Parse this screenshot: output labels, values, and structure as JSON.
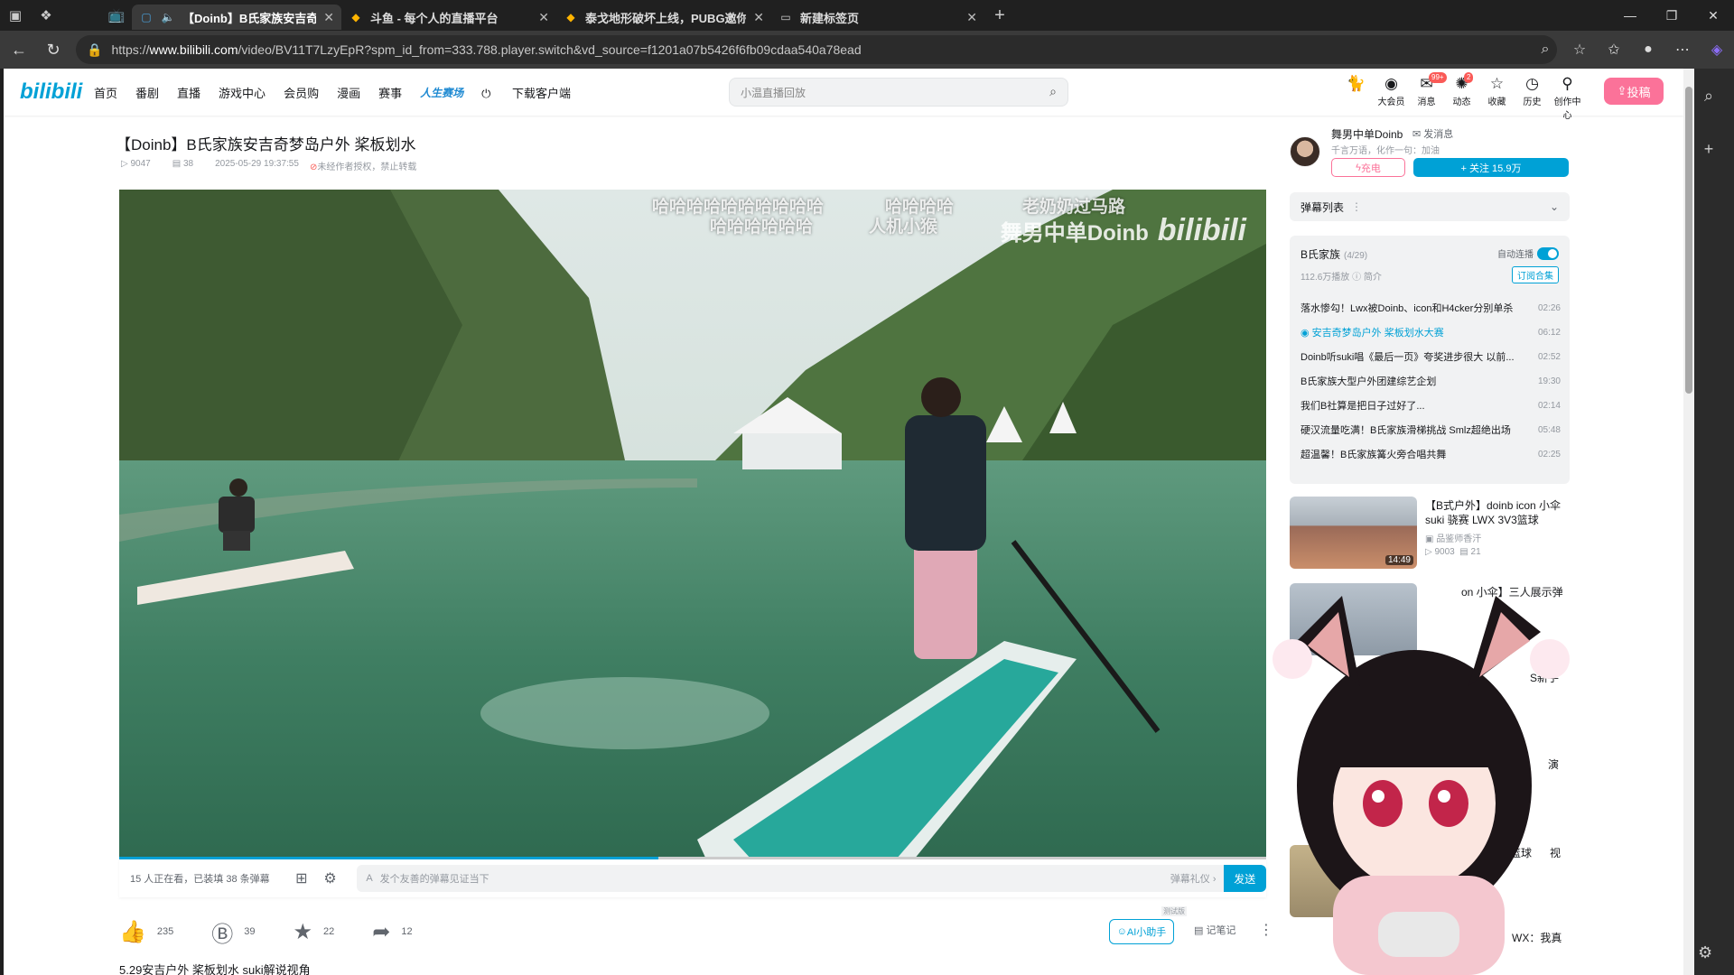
{
  "browser": {
    "tabs": [
      {
        "title": "【Doinb】B氏家族安吉奇梦",
        "active": true
      },
      {
        "title": "斗鱼 - 每个人的直播平台",
        "active": false
      },
      {
        "title": "泰戈地形破坏上线，PUBG邀你游",
        "active": false
      },
      {
        "title": "新建标签页",
        "active": false
      }
    ],
    "url_prefix": "https://",
    "url_host": "www.bilibili.com",
    "url_path": "/video/BV11T7LzyEpR?spm_id_from=333.788.player.switch&vd_source=f1201a07b5426f6fb09cdaa540a78ead"
  },
  "header": {
    "logo": "bilibili",
    "nav": [
      "首页",
      "番剧",
      "直播",
      "游戏中心",
      "会员购",
      "漫画",
      "赛事",
      "人生赛场",
      "下载客户端"
    ],
    "search_placeholder": "小温直播回放",
    "icons": [
      {
        "label": "",
        "icon": "avatar-icon",
        "badge": ""
      },
      {
        "label": "大会员",
        "icon": "vip-icon",
        "badge": ""
      },
      {
        "label": "消息",
        "icon": "message-icon",
        "badge": "99+"
      },
      {
        "label": "动态",
        "icon": "dynamic-icon",
        "badge": "2"
      },
      {
        "label": "收藏",
        "icon": "star-icon",
        "badge": ""
      },
      {
        "label": "历史",
        "icon": "history-icon",
        "badge": ""
      },
      {
        "label": "创作中心",
        "icon": "creator-icon",
        "badge": ""
      }
    ],
    "upload_label": "投稿"
  },
  "video": {
    "title": "【Doinb】B氏家族安吉奇梦岛户外 桨板划水",
    "views": "9047",
    "danmaku_count": "38",
    "date": "2025-05-29 19:37:55",
    "copyright_note": "未经作者授权，禁止转载",
    "danmaku_texts": [
      "哈哈哈哈哈哈哈哈哈哈",
      "哈哈哈哈哈哈",
      "哈哈哈哈",
      "人机小猴",
      "老奶奶过马路"
    ],
    "watermark_user": "舞男中单Doinb",
    "watermark_logo": "bilibili",
    "progress": 0.47
  },
  "sendbar": {
    "viewers_text": "15 人正在看，已装填 38 条弹幕",
    "input_placeholder": "发个友善的弹幕见证当下",
    "etiquette": "弹幕礼仪 ›",
    "send_label": "发送"
  },
  "actions": {
    "like": "235",
    "coin": "39",
    "favorite": "22",
    "share": "12",
    "ai_label": "AI小助手",
    "ai_tag": "测试版",
    "note_label": "记笔记"
  },
  "description": "5.29安吉户外 桨板划水 suki解说视角",
  "uploader": {
    "name": "舞男中单Doinb",
    "message_label": "发消息",
    "signature": "千言万语，化作一句：加油",
    "charge_label": "充电",
    "follow_label": "+ 关注 15.9万"
  },
  "danmaku_list_label": "弹幕列表",
  "collection": {
    "name": "B氏家族",
    "count": "(4/29)",
    "autoplay_label": "自动连播",
    "plays": "112.6万播放",
    "intro_label": "简介",
    "subscribe_label": "订阅合集",
    "episodes": [
      {
        "title": "落水惨勾！Lwx被Doinb、icon和H4cker分别单杀",
        "duration": "02:26",
        "current": false
      },
      {
        "title": "安吉奇梦岛户外 桨板划水大赛",
        "duration": "06:12",
        "current": true
      },
      {
        "title": "Doinb听suki唱《最后一页》夸奖进步很大 以前...",
        "duration": "02:52",
        "current": false
      },
      {
        "title": "B氏家族大型户外团建综艺企划",
        "duration": "19:30",
        "current": false
      },
      {
        "title": "我们B社算是把日子过好了...",
        "duration": "02:14",
        "current": false
      },
      {
        "title": "硬汉流量吃满！B氏家族滑梯挑战 Smlz超绝出场",
        "duration": "05:48",
        "current": false
      },
      {
        "title": "超温馨！B氏家族篝火旁合唱共舞",
        "duration": "02:25",
        "current": false
      }
    ]
  },
  "recommendations": [
    {
      "title": "【B式户外】doinb icon 小伞 suki 骁赛 LWX 3V3篮球",
      "up": "品鉴师香汗",
      "views": "9003",
      "danmaku": "21",
      "duration": "14:49"
    }
  ],
  "partial_texts": [
    "on 小伞】三人展示弹",
    "S新手",
    "演",
    "】户外打篮球",
    "视",
    "WX：我真"
  ],
  "colors": {
    "brand_blue": "#00a1d6",
    "brand_pink": "#fb7299"
  }
}
